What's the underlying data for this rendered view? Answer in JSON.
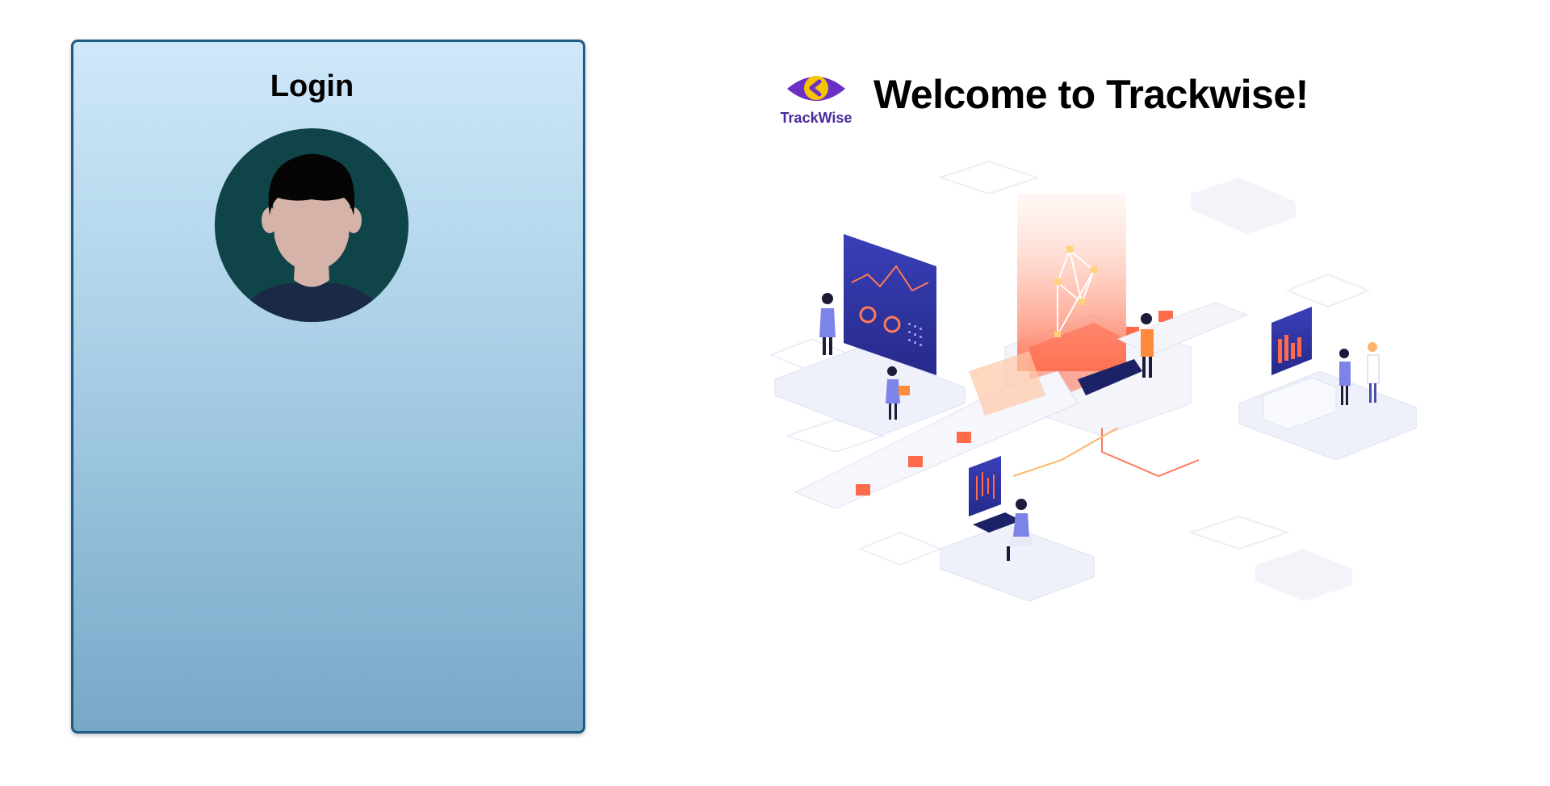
{
  "login": {
    "title": "Login"
  },
  "brand": {
    "logo_icon": "trackwise-eye-icon",
    "name": "TrackWise"
  },
  "welcome": {
    "heading": "Welcome to Trackwise!"
  },
  "colors": {
    "card_border": "#1e5a86",
    "card_gradient_top": "#cfe8fa",
    "card_gradient_bottom": "#77a8c8",
    "avatar_bg": "#0f4448",
    "brand_purple": "#6b2fc4",
    "brand_yellow": "#f5c400"
  },
  "illustration": {
    "icon": "isometric-data-analytics-illustration"
  }
}
